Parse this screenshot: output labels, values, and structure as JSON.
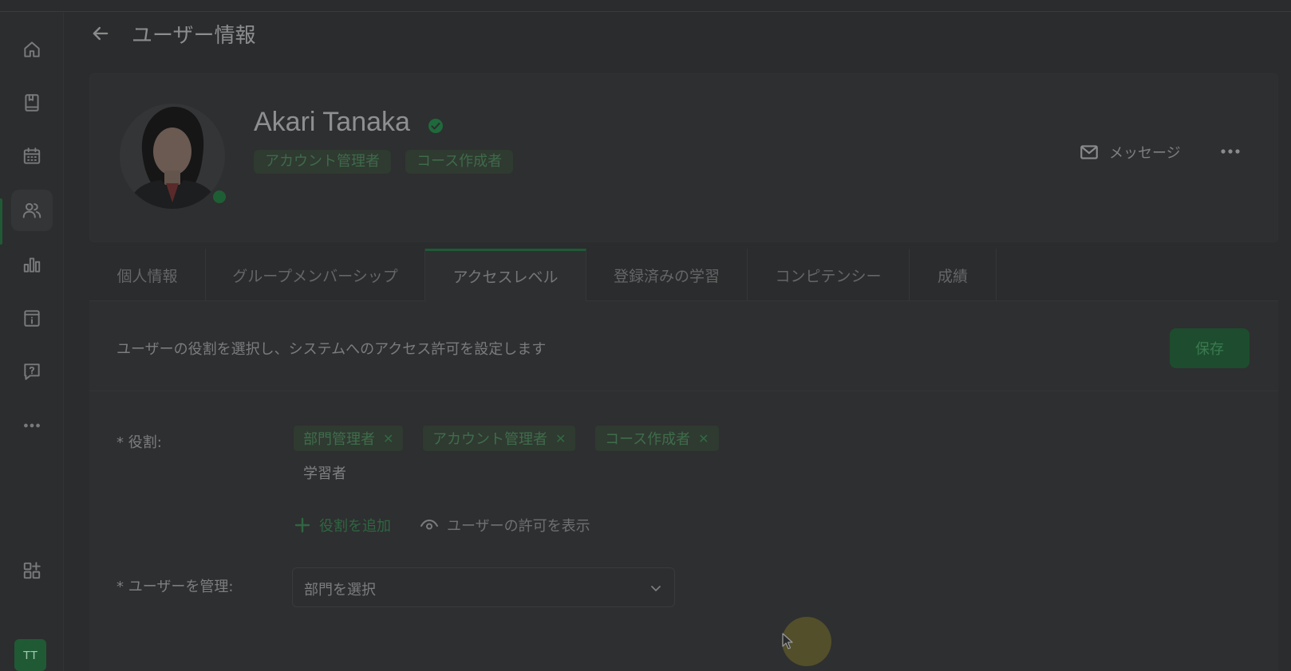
{
  "header": {
    "title": "ユーザー情報"
  },
  "sidebar": {
    "items": [
      {
        "icon": "home-icon"
      },
      {
        "icon": "book-icon"
      },
      {
        "icon": "calendar-icon"
      },
      {
        "icon": "users-icon",
        "active": true
      },
      {
        "icon": "bar-chart-icon"
      },
      {
        "icon": "catalog-icon"
      },
      {
        "icon": "help-chat-icon"
      },
      {
        "icon": "more-horizontal-icon"
      }
    ],
    "apps_icon": "apps-add-icon",
    "user_initials": "TT"
  },
  "profile": {
    "name": "Akari Tanaka",
    "roles": [
      "アカウント管理者",
      "コース作成者"
    ],
    "message_label": "メッセージ",
    "online": true
  },
  "tabs": [
    {
      "label": "個人情報"
    },
    {
      "label": "グループメンバーシップ"
    },
    {
      "label": "アクセスレベル",
      "active": true
    },
    {
      "label": "登録済みの学習"
    },
    {
      "label": "コンピテンシー"
    },
    {
      "label": "成績"
    }
  ],
  "access": {
    "description": "ユーザーの役割を選択し、システムへのアクセス許可を設定します",
    "save_label": "保存",
    "roles_label": "* 役割:",
    "selected_roles": [
      "部門管理者",
      "アカウント管理者",
      "コース作成者"
    ],
    "available_role": "学習者",
    "add_role_label": "役割を追加",
    "view_permissions_label": "ユーザーの許可を表示",
    "manage_label": "* ユーザーを管理:",
    "department_placeholder": "部門を選択"
  },
  "colors": {
    "accent": "#1f5a35",
    "background": "#2b2c2d"
  }
}
